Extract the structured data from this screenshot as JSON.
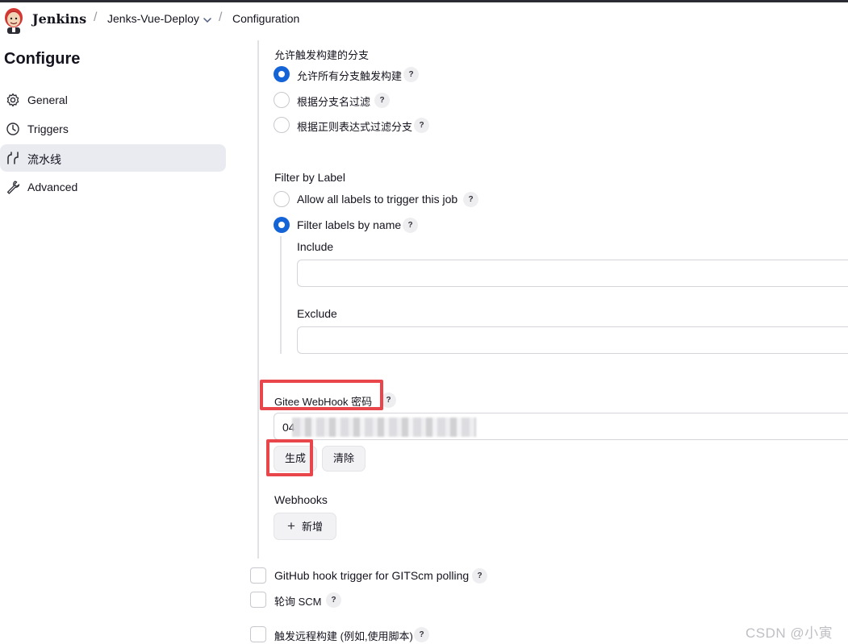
{
  "header": {
    "brand": "Jenkins",
    "crumbs": [
      "Jenks-Vue-Deploy",
      "Configuration"
    ],
    "separator": "/"
  },
  "sidebar": {
    "title": "Configure",
    "items": [
      {
        "label": "General",
        "icon": "gear-icon",
        "active": false
      },
      {
        "label": "Triggers",
        "icon": "clock-icon",
        "active": false
      },
      {
        "label": "流水线",
        "icon": "pipeline-icon",
        "active": true
      },
      {
        "label": "Advanced",
        "icon": "wrench-icon",
        "active": false
      }
    ]
  },
  "branch_section": {
    "title": "允许触发构建的分支",
    "options": [
      {
        "label": "允许所有分支触发构建",
        "selected": true
      },
      {
        "label": "根据分支名过滤",
        "selected": false
      },
      {
        "label": "根据正则表达式过滤分支",
        "selected": false
      }
    ]
  },
  "label_section": {
    "title": "Filter by Label",
    "options": [
      {
        "label": "Allow all labels to trigger this job",
        "selected": false
      },
      {
        "label": "Filter labels by name",
        "selected": true
      }
    ],
    "include_label": "Include",
    "include_value": "",
    "exclude_label": "Exclude",
    "exclude_value": ""
  },
  "webhook_password": {
    "label": "Gitee WebHook 密码",
    "value_visible": "04",
    "generate_button": "生成",
    "clear_button": "清除"
  },
  "webhooks": {
    "label": "Webhooks",
    "add_button": "新增",
    "add_icon": "+"
  },
  "triggers": [
    {
      "label": "GitHub hook trigger for GITScm polling",
      "checked": false
    },
    {
      "label": "轮询 SCM",
      "checked": false
    },
    {
      "label": "触发远程构建 (例如,使用脚本)",
      "checked": false
    }
  ],
  "help_glyph": "?",
  "watermark": "CSDN @小寅",
  "colors": {
    "accent": "#1464d8",
    "highlight": "#e8464b",
    "active_nav": "#e9ebf0"
  }
}
